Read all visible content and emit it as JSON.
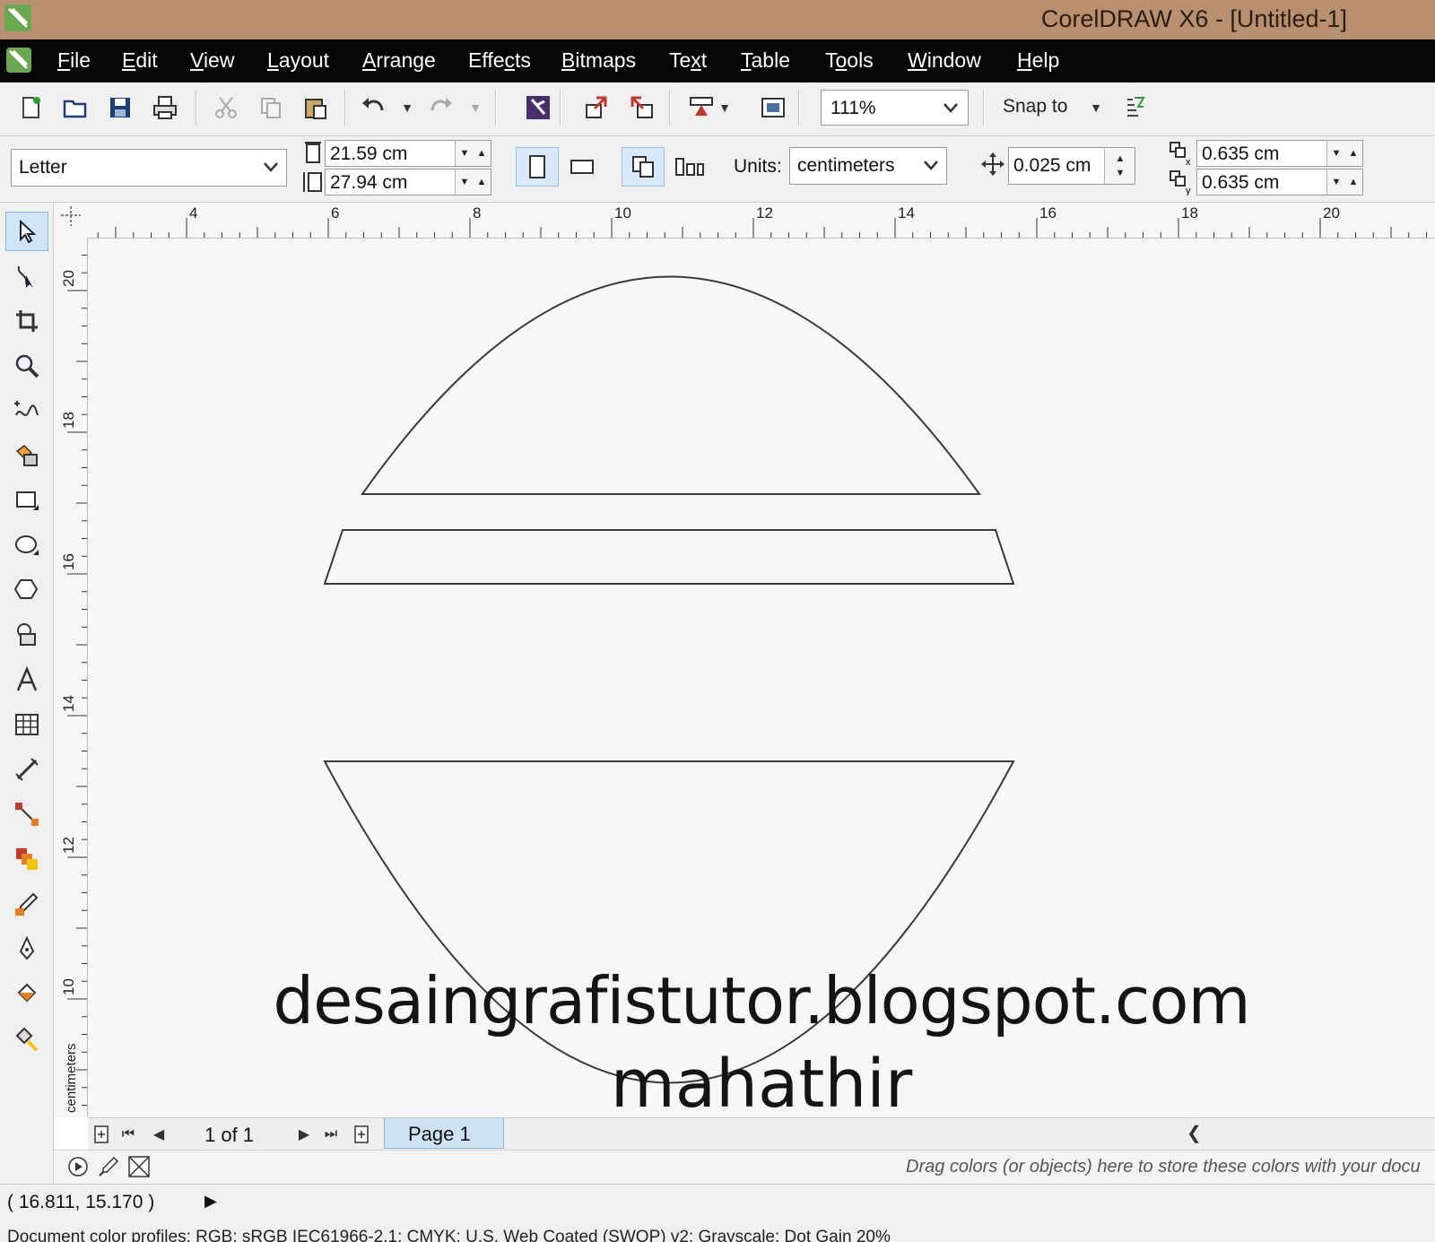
{
  "window": {
    "title": "CorelDRAW X6 - [Untitled-1]"
  },
  "menu": {
    "items": [
      {
        "label": "File",
        "underline": "F",
        "rest": "ile"
      },
      {
        "label": "Edit",
        "underline": "E",
        "rest": "dit"
      },
      {
        "label": "View",
        "underline": "V",
        "rest": "iew"
      },
      {
        "label": "Layout",
        "underline": "L",
        "rest": "ayout"
      },
      {
        "label": "Arrange",
        "underline": "A",
        "rest": "rrange"
      },
      {
        "label": "Effects",
        "pre": "Effe",
        "underline": "c",
        "rest": "ts"
      },
      {
        "label": "Bitmaps",
        "underline": "B",
        "rest": "itmaps"
      },
      {
        "label": "Text",
        "pre": "Te",
        "underline": "x",
        "rest": "t"
      },
      {
        "label": "Table",
        "underline": "T",
        "rest": "able"
      },
      {
        "label": "Tools",
        "pre": "T",
        "underline": "o",
        "rest": "ols"
      },
      {
        "label": "Window",
        "underline": "W",
        "rest": "indow"
      },
      {
        "label": "Help",
        "underline": "H",
        "rest": "elp"
      }
    ]
  },
  "toolbar": {
    "zoom_level": "111%",
    "snap_label": "Snap to",
    "icons": [
      "new-document-icon",
      "open-icon",
      "save-icon",
      "print-icon",
      "cut-icon",
      "copy-icon",
      "paste-icon",
      "undo-icon",
      "redo-icon",
      "search-content-icon",
      "import-icon",
      "export-icon",
      "publish-icon",
      "application-launcher-icon",
      "snap-options-icon"
    ]
  },
  "property_bar": {
    "page_size": "Letter",
    "width": "21.59 cm",
    "height": "27.94 cm",
    "units_label": "Units:",
    "units_value": "centimeters",
    "nudge": "0.025 cm",
    "dup_x": "0.635 cm",
    "dup_y": "0.635 cm",
    "orientation": "portrait"
  },
  "toolbox": {
    "tools": [
      "pick-tool-icon",
      "shape-tool-icon",
      "crop-tool-icon",
      "zoom-tool-icon",
      "freehand-tool-icon",
      "smart-fill-icon",
      "rectangle-tool-icon",
      "ellipse-tool-icon",
      "polygon-tool-icon",
      "basic-shapes-icon",
      "text-tool-icon",
      "table-tool-icon",
      "dimension-tool-icon",
      "connector-tool-icon",
      "blend-tool-icon",
      "eyedropper-tool-icon",
      "outline-pen-icon",
      "fill-tool-icon",
      "interactive-fill-icon"
    ],
    "active": "pick-tool-icon"
  },
  "rulers": {
    "horizontal_labels": [
      "4",
      "6",
      "8",
      "10",
      "12",
      "14",
      "16",
      "18",
      "20"
    ],
    "vertical_labels": [
      "20",
      "18",
      "16",
      "14",
      "12",
      "10"
    ],
    "unit_label": "centimeters"
  },
  "canvas": {
    "watermark_line1": "desaingrafistutor.blogspot.com",
    "watermark_line2": "mahathir"
  },
  "page_navigator": {
    "count": "1 of 1",
    "tab": "Page 1"
  },
  "color_tray": {
    "hint": "Drag colors (or objects) here to store these colors with your docu"
  },
  "status": {
    "coordinates": "( 16.811, 15.170 )",
    "color_profiles": "Document color profiles: RGB: sRGB IEC61966-2.1; CMYK: U.S. Web Coated (SWOP) v2; Grayscale: Dot Gain 20%"
  },
  "colors": {
    "titlebar": "#b88f6f",
    "menubar": "#060606",
    "selection": "#d0e4f7"
  }
}
